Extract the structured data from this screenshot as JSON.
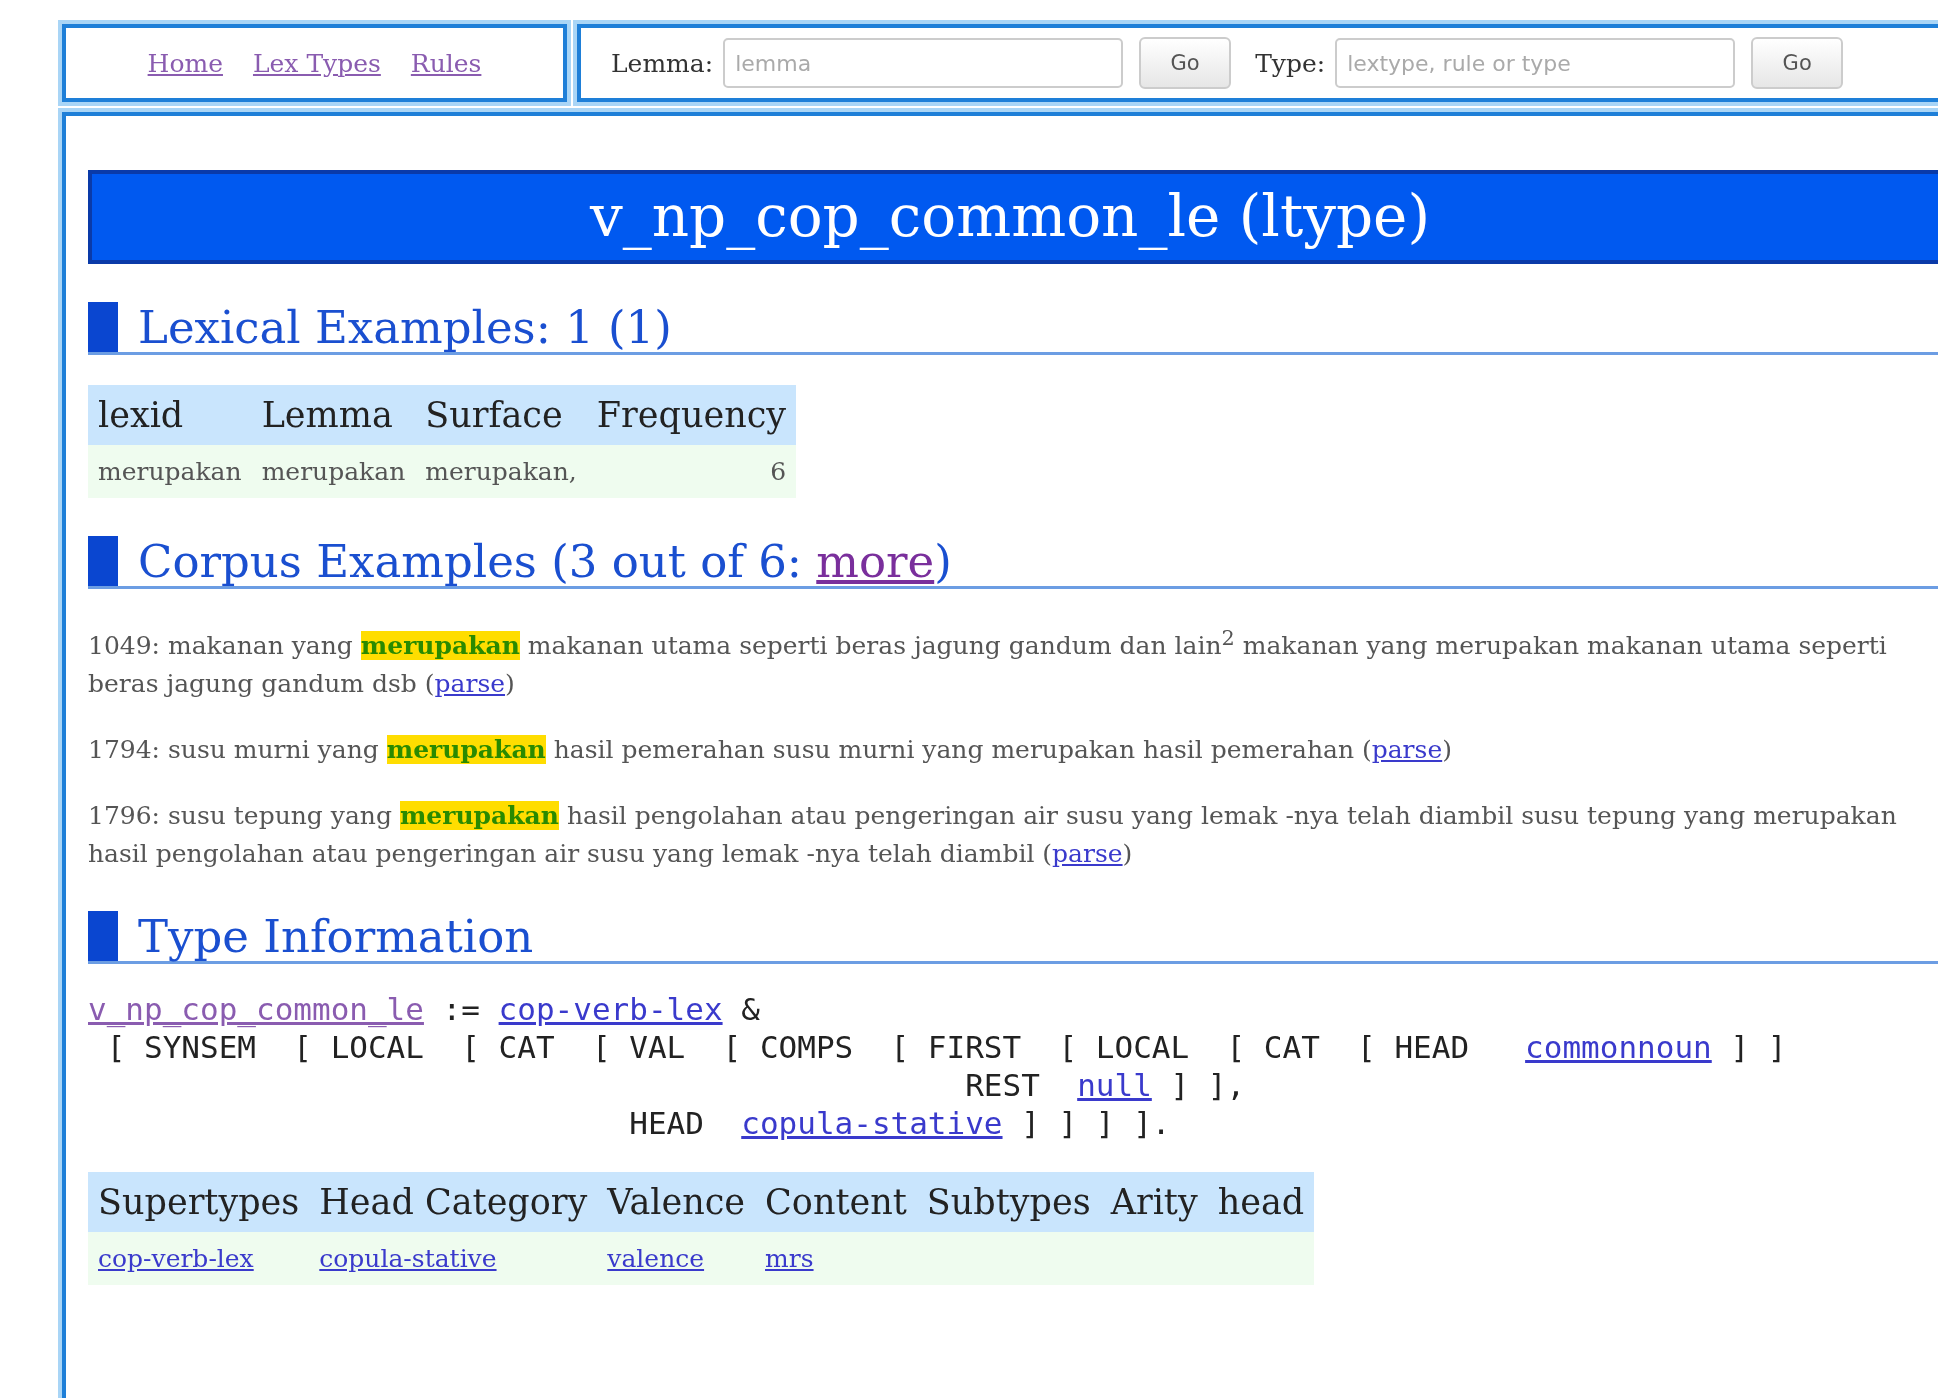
{
  "nav": {
    "links": [
      "Home",
      "Lex Types",
      "Rules"
    ]
  },
  "search": [
    {
      "label": "Lemma:",
      "placeholder": "lemma",
      "button": "Go"
    },
    {
      "label": "Type:",
      "placeholder": "lextype, rule or type",
      "button": "Go"
    }
  ],
  "title": "v_np_cop_common_le (ltype)",
  "lexical": {
    "heading": {
      "text": "Lexical Examples: 1 (1)"
    },
    "columns": [
      "lexid",
      "Lemma",
      "Surface",
      "Frequency"
    ],
    "rows": [
      [
        "merupakan",
        "merupakan",
        "merupakan,",
        "6"
      ]
    ]
  },
  "corpus": {
    "heading": {
      "text": "Corpus Examples (3 out of 6: ",
      "link": "more",
      "after": ")"
    },
    "examples": [
      {
        "id": "1049:",
        "before": "makanan yang",
        "highlight": "merupakan",
        "after": "makanan utama seperti beras jagung gandum dan lain$^{2}$ makanan yang merupakan makanan utama seperti beras jagung gandum dsb (",
        "link": "parse",
        "end": ")"
      },
      {
        "id": "1794:",
        "before": "susu murni yang",
        "highlight": "merupakan",
        "after": "hasil pemerahan susu murni yang merupakan hasil pemerahan (",
        "link": "parse",
        "end": ")"
      },
      {
        "id": "1796:",
        "before": "susu tepung yang",
        "highlight": "merupakan",
        "after": "hasil pengolahan atau pengeringan air susu yang lemak -nya telah diambil susu tepung yang merupakan hasil pengolahan atau pengeringan air susu yang lemak -nya telah diambil (",
        "link": "parse",
        "end": ")"
      }
    ]
  },
  "type_info": {
    "heading": {
      "text": "Type Information"
    },
    "code": [
      [
        {
          "link": "v_np_cop_common_le"
        },
        {
          "text": " := "
        },
        {
          "link": "cop-verb-lex"
        },
        {
          "text": " &"
        }
      ],
      [
        {
          "text": " [ SYNSEM  [ LOCAL  [ CAT  [ VAL  [ COMPS  [ FIRST  [ LOCAL  [ CAT  [ HEAD   "
        },
        {
          "link": "commonnoun"
        },
        {
          "text": " ] ]"
        }
      ],
      [
        {
          "text": "                                               REST  "
        },
        {
          "link": "null"
        },
        {
          "text": " ] ],"
        }
      ],
      [
        {
          "text": "                             HEAD  "
        },
        {
          "link": "copula-stative"
        },
        {
          "text": " ] ] ] ]."
        }
      ]
    ],
    "columns": [
      "Supertypes",
      "Head Category",
      "Valence",
      "Content",
      "Subtypes",
      "Arity",
      "head"
    ],
    "rows": [
      [
        "cop-verb-lex",
        "copula-stative",
        "valence",
        "mrs"
      ]
    ]
  }
}
